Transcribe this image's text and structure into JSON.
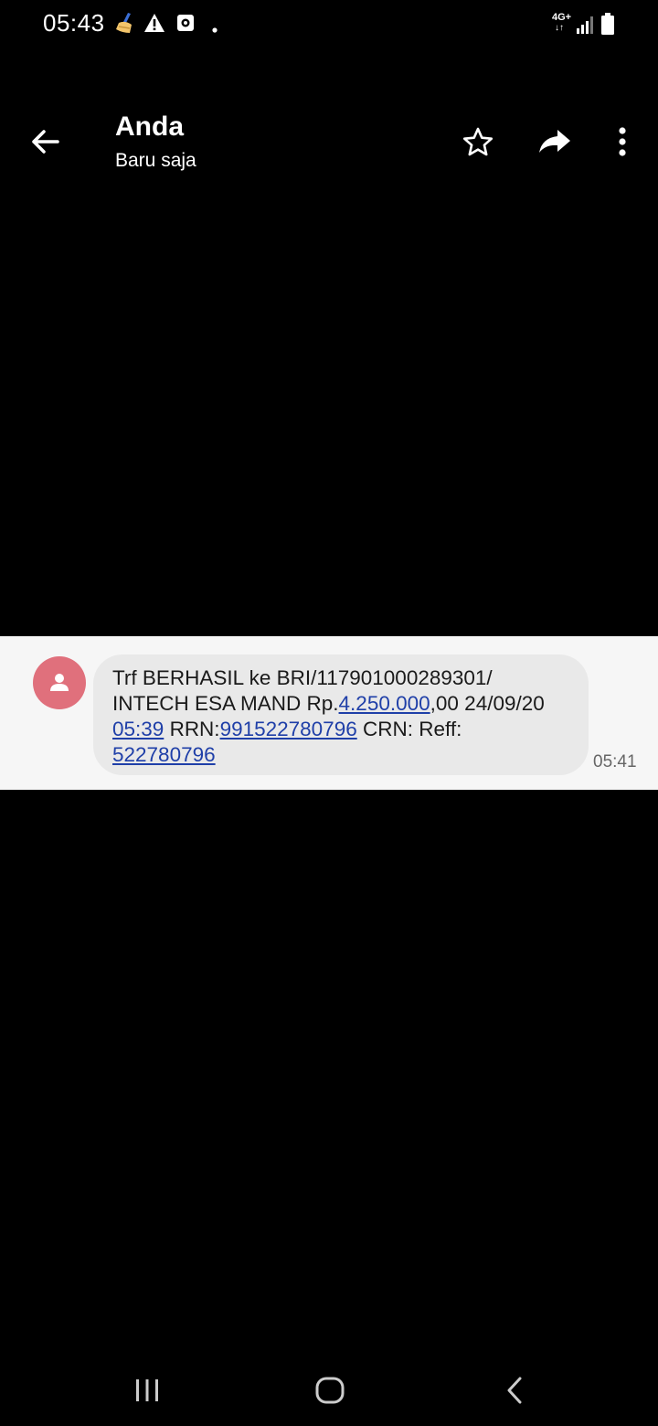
{
  "status_bar": {
    "time": "05:43",
    "network": "4G+",
    "icons": [
      "cleaner-icon",
      "warning-icon",
      "media-icon",
      "dot-icon",
      "network-arrows-icon",
      "signal-icon",
      "battery-icon"
    ]
  },
  "header": {
    "title": "Anda",
    "subtitle": "Baru saja",
    "actions": [
      "back-arrow-icon",
      "star-icon",
      "forward-icon",
      "more-vert-icon"
    ]
  },
  "message": {
    "line1": "Trf BERHASIL ke BRI/117901000289301/",
    "line2_prefix": "INTECH ESA MAND Rp.",
    "amount_link": "4.250.000",
    "line2_suffix": ",00 24/09/20",
    "time_link": "05:39",
    "rrn_label": " RRN:",
    "rrn_link": "991522780796",
    "crn_label": " CRN: Reff:",
    "reff_link": "522780796",
    "timestamp": "05:41"
  },
  "nav": {
    "icons": [
      "recent-apps-icon",
      "home-icon",
      "back-icon"
    ]
  }
}
